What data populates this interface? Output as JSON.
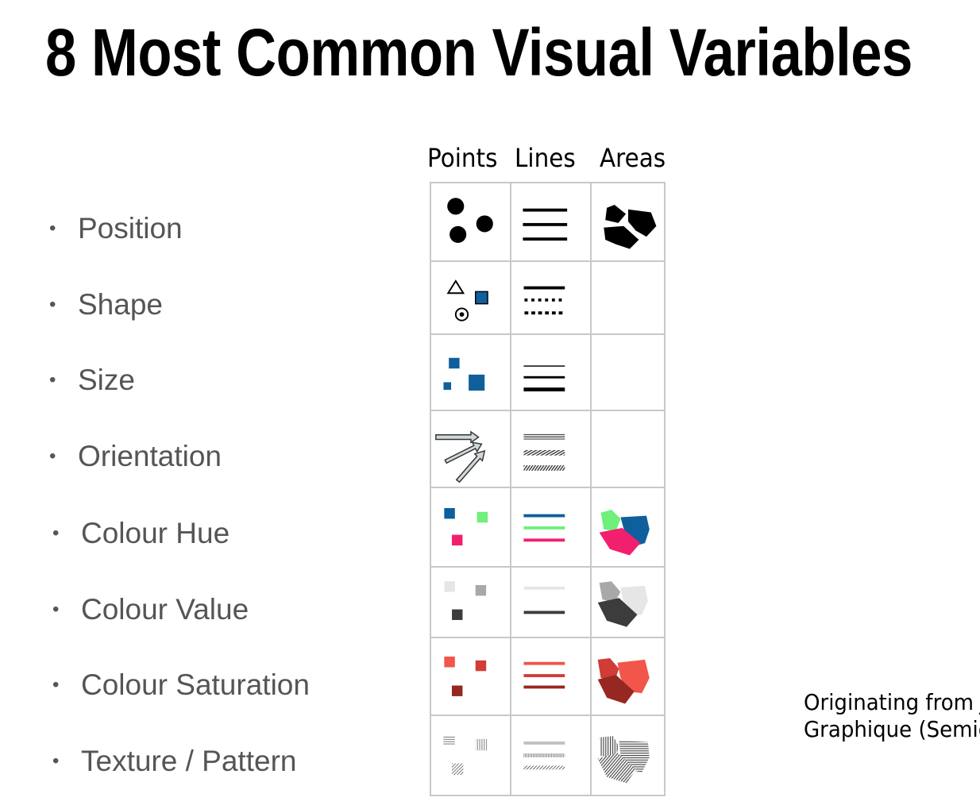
{
  "title": "8 Most Common Visual Variables",
  "columns": [
    "Points",
    "Lines",
    "Areas"
  ],
  "variables": [
    {
      "label": "Position"
    },
    {
      "label": "Shape"
    },
    {
      "label": "Size"
    },
    {
      "label": "Orientation"
    },
    {
      "label": "Colour Hue"
    },
    {
      "label": "Colour Value"
    },
    {
      "label": "Colour Saturation"
    },
    {
      "label": "Texture / Pattern"
    }
  ],
  "bullet": "•",
  "credit": {
    "line1": "Originating from J",
    "line2": "Graphique (Semio"
  },
  "colors": {
    "blue": "#0f5f9c",
    "green": "#6ef07a",
    "pink": "#f21f6e",
    "light_gray": "#e6e6e6",
    "mid_gray": "#a8a8a8",
    "dark_gray": "#3c3c3c",
    "sat_light": "#f2554a",
    "sat_mid": "#d23c36",
    "sat_dark": "#962821",
    "grid_border": "#c8c8c8",
    "label_text": "#555555"
  }
}
